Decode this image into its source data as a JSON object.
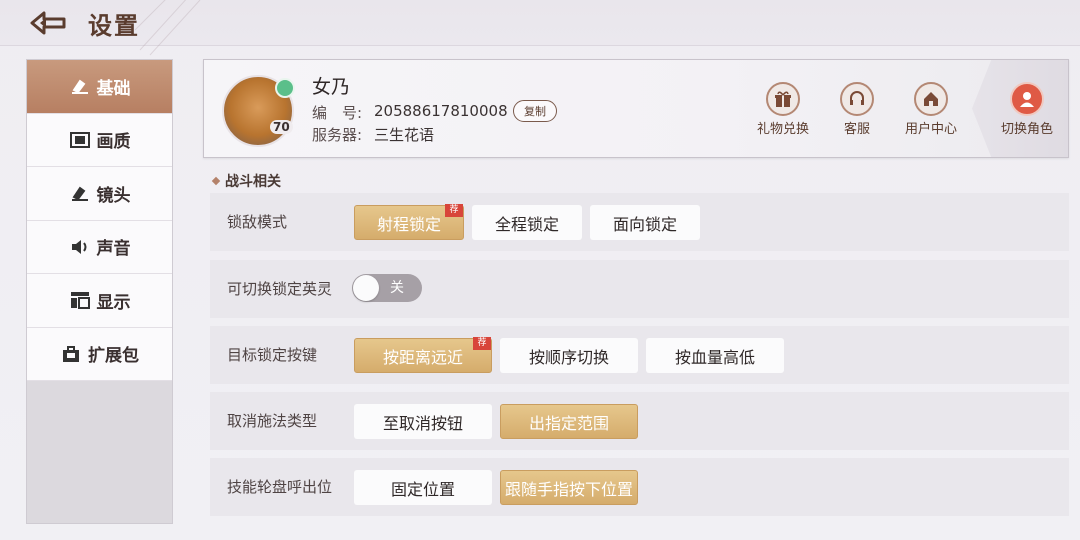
{
  "header": {
    "title": "设置"
  },
  "sidebar": {
    "items": [
      {
        "label": "基础",
        "icon": "hammer-icon",
        "active": true
      },
      {
        "label": "画质",
        "icon": "film-icon",
        "active": false
      },
      {
        "label": "镜头",
        "icon": "camera-icon",
        "active": false
      },
      {
        "label": "声音",
        "icon": "speaker-icon",
        "active": false
      },
      {
        "label": "显示",
        "icon": "layout-icon",
        "active": false
      },
      {
        "label": "扩展包",
        "icon": "package-icon",
        "active": false
      }
    ]
  },
  "profile": {
    "name": "女乃",
    "id_label": "编　号:",
    "id_value": "20588617810008",
    "copy_label": "复制",
    "server_label": "服务器:",
    "server_value": "三生花语",
    "level": "70",
    "actions": [
      {
        "label": "礼物兑换",
        "icon": "gift-icon"
      },
      {
        "label": "客服",
        "icon": "headset-icon"
      },
      {
        "label": "用户中心",
        "icon": "home-icon"
      },
      {
        "label": "切换角色",
        "icon": "user-switch-icon"
      }
    ]
  },
  "section": {
    "title": "战斗相关"
  },
  "settings": {
    "lock_mode": {
      "label": "锁敌模式",
      "options": [
        "射程锁定",
        "全程锁定",
        "面向锁定"
      ],
      "selected": "射程锁定",
      "recommended_tag": "荐"
    },
    "switch_lock": {
      "label": "可切换锁定英灵",
      "state_text": "关"
    },
    "target_key": {
      "label": "目标锁定按键",
      "options": [
        "按距离远近",
        "按顺序切换",
        "按血量高低"
      ],
      "selected": "按距离远近",
      "recommended_tag": "荐"
    },
    "cancel_type": {
      "label": "取消施法类型",
      "options": [
        "至取消按钮",
        "出指定范围"
      ],
      "selected": "出指定范围"
    },
    "wheel_pos": {
      "label": "技能轮盘呼出位",
      "options": [
        "固定位置",
        "跟随手指按下位置"
      ],
      "selected": "跟随手指按下位置"
    }
  },
  "colors": {
    "accent": "#c89a7e",
    "selected_option": "#d5ac6c",
    "rec_tag": "#d8453a",
    "switch_role": "#df5a45"
  }
}
